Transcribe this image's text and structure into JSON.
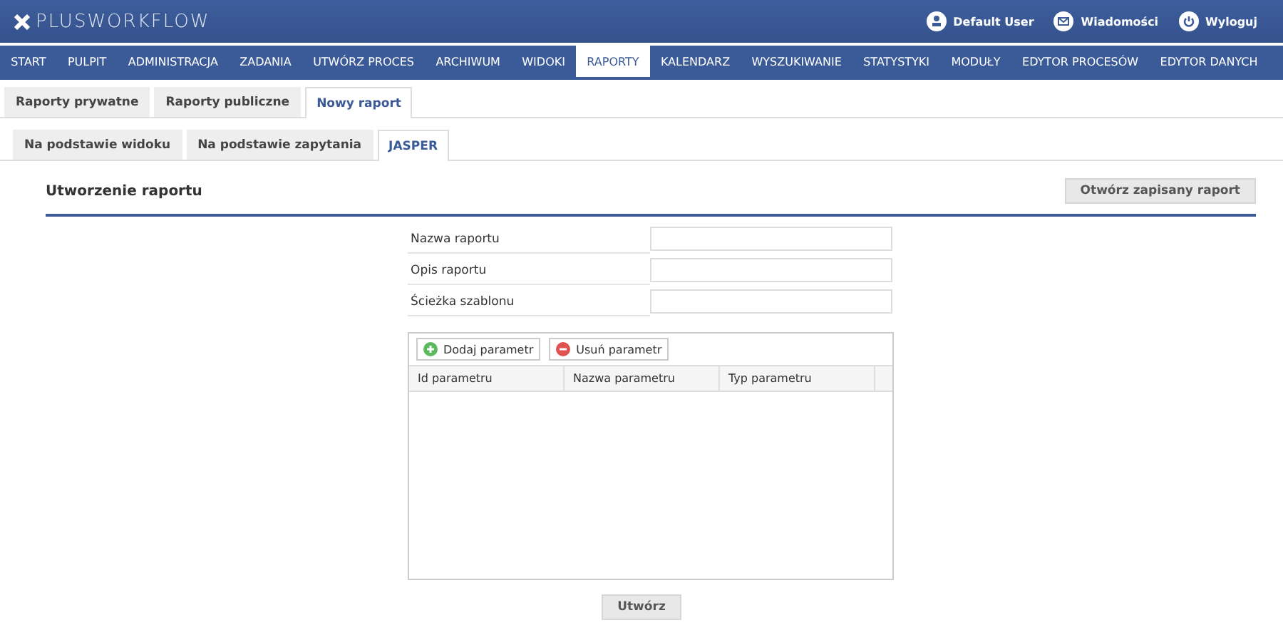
{
  "header": {
    "logo": "PLUSWORKFLOW",
    "links": [
      {
        "kind": "user",
        "label": "Default User"
      },
      {
        "kind": "mail",
        "label": "Wiadomości"
      },
      {
        "kind": "power",
        "label": "Wyloguj"
      }
    ]
  },
  "nav": [
    {
      "label": "START",
      "selected": false
    },
    {
      "label": "PULPIT",
      "selected": false
    },
    {
      "label": "ADMINISTRACJA",
      "selected": false
    },
    {
      "label": "ZADANIA",
      "selected": false
    },
    {
      "label": "UTWÓRZ PROCES",
      "selected": false
    },
    {
      "label": "ARCHIWUM",
      "selected": false
    },
    {
      "label": "WIDOKI",
      "selected": false
    },
    {
      "label": "RAPORTY",
      "selected": true
    },
    {
      "label": "KALENDARZ",
      "selected": false
    },
    {
      "label": "WYSZUKIWANIE",
      "selected": false
    },
    {
      "label": "STATYSTYKI",
      "selected": false
    },
    {
      "label": "MODUŁY",
      "selected": false
    },
    {
      "label": "EDYTOR PROCESÓW",
      "selected": false
    },
    {
      "label": "EDYTOR DANYCH",
      "selected": false
    }
  ],
  "tabs": [
    {
      "label": "Raporty prywatne",
      "selected": false
    },
    {
      "label": "Raporty publiczne",
      "selected": false
    },
    {
      "label": "Nowy raport",
      "selected": true
    }
  ],
  "subtabs": [
    {
      "label": "Na podstawie widoku",
      "selected": false
    },
    {
      "label": "Na podstawie zapytania",
      "selected": false
    },
    {
      "label": "JASPER",
      "selected": true
    }
  ],
  "section": {
    "title": "Utworzenie raportu",
    "open_button": "Otwórz zapisany raport"
  },
  "form": [
    {
      "label": "Nazwa raportu"
    },
    {
      "label": "Opis raportu"
    },
    {
      "label": "Ścieżka szablonu"
    }
  ],
  "parameters": {
    "buttons": [
      {
        "kind": "add",
        "label": "Dodaj parametr"
      },
      {
        "kind": "remove",
        "label": "Usuń parametr"
      }
    ],
    "columns": [
      "Id parametru",
      "Nazwa parametru",
      "Typ parametru"
    ]
  },
  "submit": "Utwórz"
}
